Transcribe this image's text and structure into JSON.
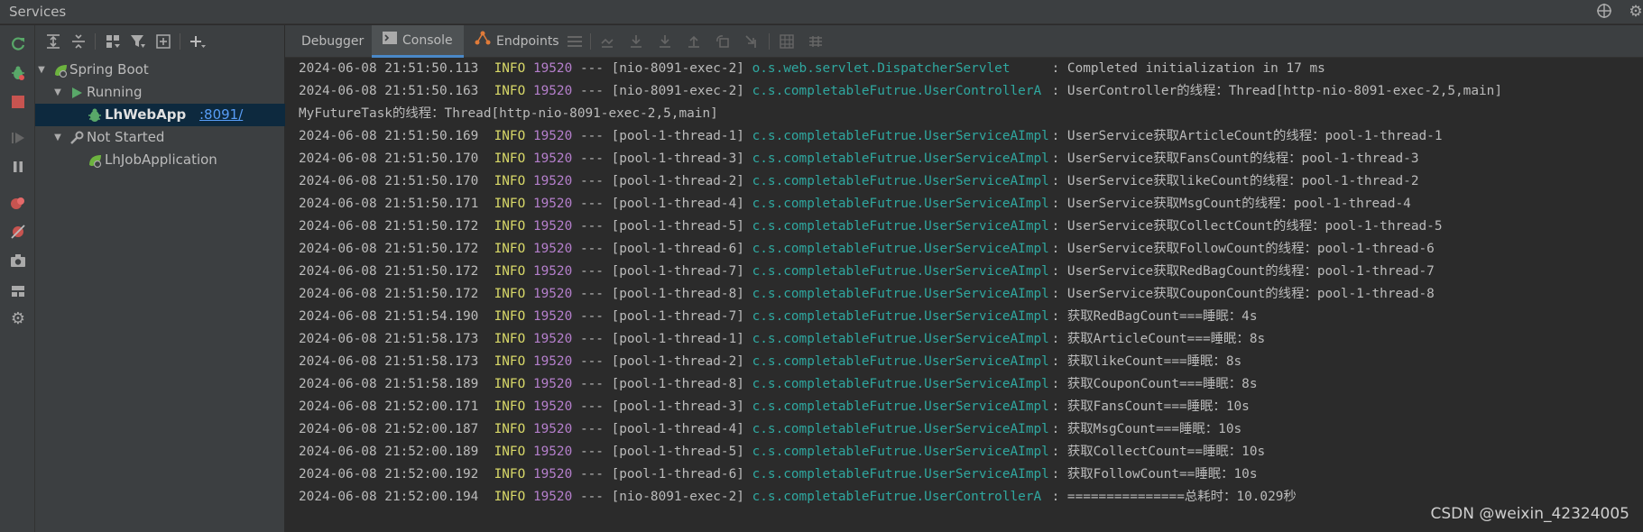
{
  "window": {
    "title": "Services"
  },
  "tree": {
    "root": "Spring Boot",
    "running_group": "Running",
    "running_app": "LhWebApp",
    "running_port": ":8091/",
    "not_started_group": "Not Started",
    "not_started_app": "LhJobApplication"
  },
  "tabs": [
    "Debugger",
    "Console",
    "Endpoints"
  ],
  "log_lines": [
    {
      "ts": "2024-06-08 21:51:50.113",
      "level": "INFO",
      "pid": "19520",
      "sep": "---",
      "thread": "[nio-8091-exec-2]",
      "logger": "o.s.web.servlet.DispatcherServlet",
      "msg": ": Completed initialization in 17 ms"
    },
    {
      "ts": "2024-06-08 21:51:50.163",
      "level": "INFO",
      "pid": "19520",
      "sep": "---",
      "thread": "[nio-8091-exec-2]",
      "logger": "c.s.completableFutrue.UserControllerA",
      "msg": ": UserController的线程：Thread[http-nio-8091-exec-2,5,main]"
    },
    {
      "plain": "MyFutureTask的线程：Thread[http-nio-8091-exec-2,5,main]"
    },
    {
      "ts": "2024-06-08 21:51:50.169",
      "level": "INFO",
      "pid": "19520",
      "sep": "---",
      "thread": "[pool-1-thread-1]",
      "logger": "c.s.completableFutrue.UserServiceAImpl",
      "msg": ": UserService获取ArticleCount的线程：pool-1-thread-1"
    },
    {
      "ts": "2024-06-08 21:51:50.170",
      "level": "INFO",
      "pid": "19520",
      "sep": "---",
      "thread": "[pool-1-thread-3]",
      "logger": "c.s.completableFutrue.UserServiceAImpl",
      "msg": ": UserService获取FansCount的线程：pool-1-thread-3"
    },
    {
      "ts": "2024-06-08 21:51:50.170",
      "level": "INFO",
      "pid": "19520",
      "sep": "---",
      "thread": "[pool-1-thread-2]",
      "logger": "c.s.completableFutrue.UserServiceAImpl",
      "msg": ": UserService获取likeCount的线程：pool-1-thread-2"
    },
    {
      "ts": "2024-06-08 21:51:50.171",
      "level": "INFO",
      "pid": "19520",
      "sep": "---",
      "thread": "[pool-1-thread-4]",
      "logger": "c.s.completableFutrue.UserServiceAImpl",
      "msg": ": UserService获取MsgCount的线程：pool-1-thread-4"
    },
    {
      "ts": "2024-06-08 21:51:50.172",
      "level": "INFO",
      "pid": "19520",
      "sep": "---",
      "thread": "[pool-1-thread-5]",
      "logger": "c.s.completableFutrue.UserServiceAImpl",
      "msg": ": UserService获取CollectCount的线程：pool-1-thread-5"
    },
    {
      "ts": "2024-06-08 21:51:50.172",
      "level": "INFO",
      "pid": "19520",
      "sep": "---",
      "thread": "[pool-1-thread-6]",
      "logger": "c.s.completableFutrue.UserServiceAImpl",
      "msg": ": UserService获取FollowCount的线程：pool-1-thread-6"
    },
    {
      "ts": "2024-06-08 21:51:50.172",
      "level": "INFO",
      "pid": "19520",
      "sep": "---",
      "thread": "[pool-1-thread-7]",
      "logger": "c.s.completableFutrue.UserServiceAImpl",
      "msg": ": UserService获取RedBagCount的线程：pool-1-thread-7"
    },
    {
      "ts": "2024-06-08 21:51:50.172",
      "level": "INFO",
      "pid": "19520",
      "sep": "---",
      "thread": "[pool-1-thread-8]",
      "logger": "c.s.completableFutrue.UserServiceAImpl",
      "msg": ": UserService获取CouponCount的线程：pool-1-thread-8"
    },
    {
      "ts": "2024-06-08 21:51:54.190",
      "level": "INFO",
      "pid": "19520",
      "sep": "---",
      "thread": "[pool-1-thread-7]",
      "logger": "c.s.completableFutrue.UserServiceAImpl",
      "msg": ": 获取RedBagCount===睡眠：4s"
    },
    {
      "ts": "2024-06-08 21:51:58.173",
      "level": "INFO",
      "pid": "19520",
      "sep": "---",
      "thread": "[pool-1-thread-1]",
      "logger": "c.s.completableFutrue.UserServiceAImpl",
      "msg": ": 获取ArticleCount===睡眠：8s"
    },
    {
      "ts": "2024-06-08 21:51:58.173",
      "level": "INFO",
      "pid": "19520",
      "sep": "---",
      "thread": "[pool-1-thread-2]",
      "logger": "c.s.completableFutrue.UserServiceAImpl",
      "msg": ": 获取likeCount===睡眠：8s"
    },
    {
      "ts": "2024-06-08 21:51:58.189",
      "level": "INFO",
      "pid": "19520",
      "sep": "---",
      "thread": "[pool-1-thread-8]",
      "logger": "c.s.completableFutrue.UserServiceAImpl",
      "msg": ": 获取CouponCount===睡眠：8s"
    },
    {
      "ts": "2024-06-08 21:52:00.171",
      "level": "INFO",
      "pid": "19520",
      "sep": "---",
      "thread": "[pool-1-thread-3]",
      "logger": "c.s.completableFutrue.UserServiceAImpl",
      "msg": ": 获取FansCount===睡眠：10s"
    },
    {
      "ts": "2024-06-08 21:52:00.187",
      "level": "INFO",
      "pid": "19520",
      "sep": "---",
      "thread": "[pool-1-thread-4]",
      "logger": "c.s.completableFutrue.UserServiceAImpl",
      "msg": ": 获取MsgCount===睡眠：10s"
    },
    {
      "ts": "2024-06-08 21:52:00.189",
      "level": "INFO",
      "pid": "19520",
      "sep": "---",
      "thread": "[pool-1-thread-5]",
      "logger": "c.s.completableFutrue.UserServiceAImpl",
      "msg": ": 获取CollectCount==睡眠：10s"
    },
    {
      "ts": "2024-06-08 21:52:00.192",
      "level": "INFO",
      "pid": "19520",
      "sep": "---",
      "thread": "[pool-1-thread-6]",
      "logger": "c.s.completableFutrue.UserServiceAImpl",
      "msg": ": 获取FollowCount==睡眠：10s"
    },
    {
      "ts": "2024-06-08 21:52:00.194",
      "level": "INFO",
      "pid": "19520",
      "sep": "---",
      "thread": "[nio-8091-exec-2]",
      "logger": "c.s.completableFutrue.UserControllerA",
      "msg": ": ===============总耗时：10.029秒"
    }
  ],
  "watermark": "CSDN @weixin_42324005",
  "colors": {
    "info": "#d8d868",
    "pid": "#b57fcc",
    "logger": "#2fa8a0",
    "link": "#589df6",
    "selection": "#0d293e"
  },
  "icons": [
    "rerun-icon",
    "debug-icon",
    "stop-icon",
    "resume-icon",
    "pause-icon",
    "breakpoints-icon",
    "mute-breakpoints-icon",
    "camera-icon",
    "layout-icon",
    "settings-icon",
    "expand-all-icon",
    "collapse-all-icon",
    "group-icon",
    "filter-icon",
    "new-service-icon",
    "add-icon",
    "crosshair-icon",
    "gear-icon"
  ]
}
